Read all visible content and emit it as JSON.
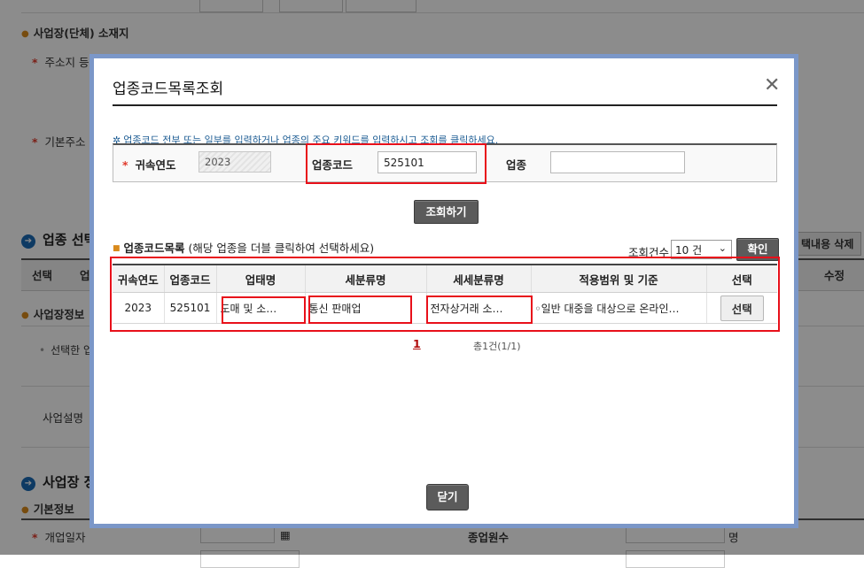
{
  "background": {
    "section_address": "사업장(단체) 소재지",
    "label_address": "주소지 등",
    "label_base_address": "기본주소",
    "title_industry": "업종 선택",
    "header_select": "선택",
    "header_industry": "업",
    "header_edit": "수정",
    "btn_delete_selected": "택내용 삭제",
    "section_business_info": "사업장정보",
    "selected_industry_text": "선택한 업",
    "label_business_desc": "사업설명",
    "title_business": "사업장 정",
    "section_basic_info": "기본정보",
    "label_open_date": "개업일자",
    "label_employees": "종업원수",
    "unit_persons": "명"
  },
  "modal": {
    "title": "업종코드목록조회",
    "close_icon": "close-icon",
    "notice": "업종코드 전부 또는 일부를 입력하거나 업종의 주요 키워드를 입력하시고 조회를 클릭하세요.",
    "search": {
      "year_label": "귀속연도",
      "year_value": "2023",
      "code_label": "업종코드",
      "code_value": "525101",
      "name_label": "업종",
      "name_value": ""
    },
    "search_button": "조회하기",
    "list": {
      "title": "업종코드목록",
      "hint": "(해당 업종을 더블 클릭하여 선택하세요)",
      "count_label": "조회건수",
      "count_value": "10 건",
      "confirm_button": "확인",
      "columns": [
        "귀속연도",
        "업종코드",
        "업태명",
        "세분류명",
        "세세분류명",
        "적용범위 및 기준",
        "선택"
      ],
      "rows": [
        {
          "year": "2023",
          "code": "525101",
          "biz_type": "도매 및 소…",
          "sub_class": "통신 판매업",
          "detail_class": "전자상거래 소…",
          "scope": "◦일반 대중을 대상으로 온라인…",
          "select_label": "선택"
        }
      ]
    },
    "pager_current": "1",
    "total_text": "총1건(1/1)",
    "close_button": "닫기"
  }
}
